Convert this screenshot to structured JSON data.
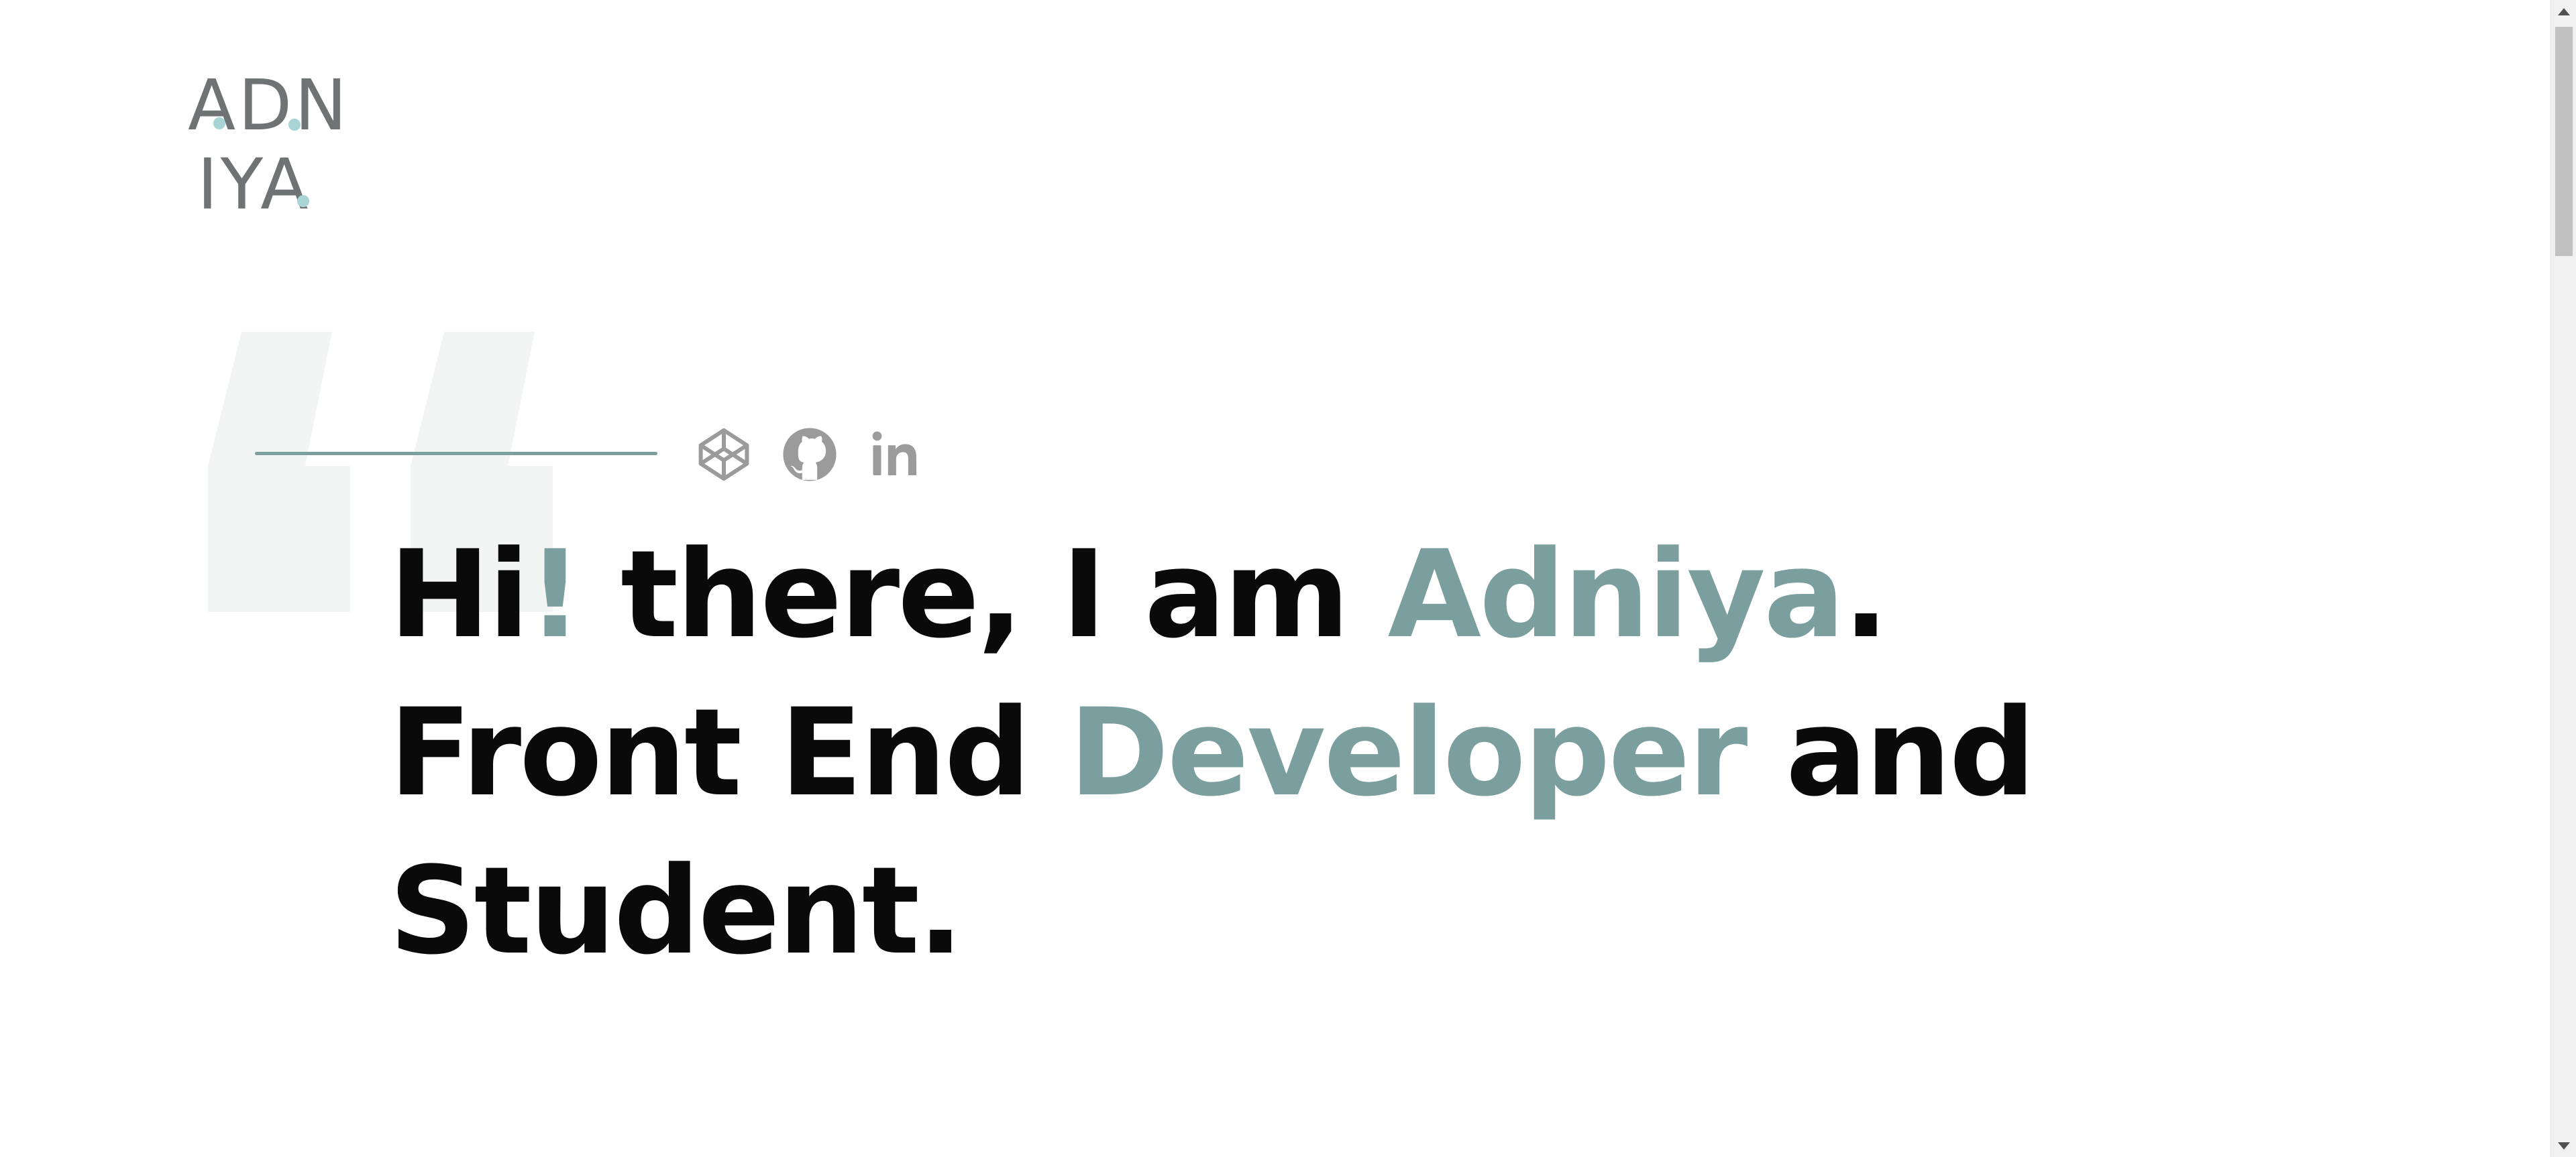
{
  "colors": {
    "accent": "#7b9e9f",
    "text": "#0a0a0a",
    "logo_gray": "#6f7374",
    "logo_dot": "#a9d4d6",
    "quote_tint": "#f3f5f5",
    "social_icon": "#9b9b9b",
    "divider": "#7b9e9f",
    "background": "#ffffff"
  },
  "logo": {
    "row1": "ADN",
    "row2": "IYA"
  },
  "social": [
    {
      "name": "codepen",
      "icon": "codepen-icon"
    },
    {
      "name": "github",
      "icon": "github-icon"
    },
    {
      "name": "linkedin",
      "icon": "linkedin-icon"
    }
  ],
  "headline": {
    "line1": {
      "hi": "Hi",
      "bang": "!",
      "middle": " there, I am ",
      "name": "Adniya",
      "end": "."
    },
    "line2": {
      "start": "Front End ",
      "role": "Developer",
      "end": " and"
    },
    "line3": {
      "text": "Student."
    }
  }
}
